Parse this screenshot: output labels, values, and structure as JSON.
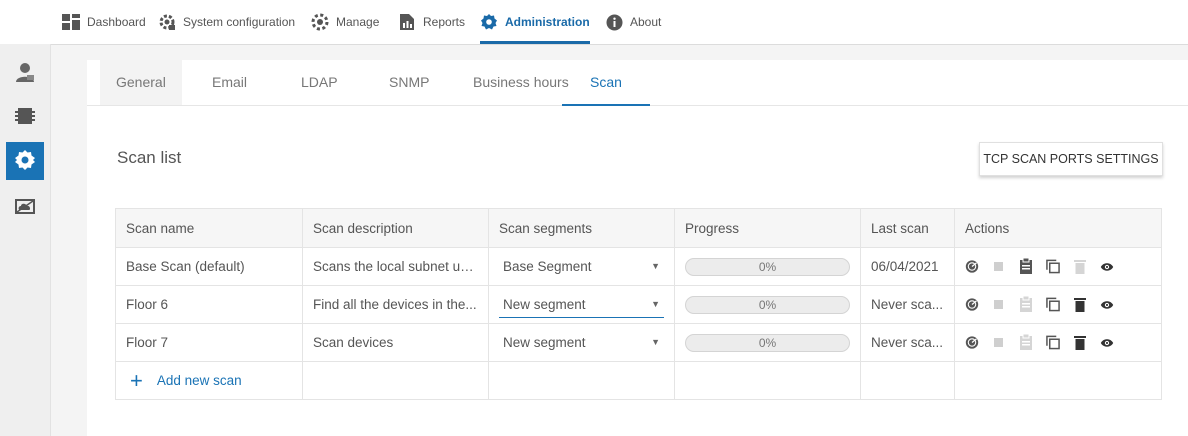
{
  "topnav": {
    "items": [
      {
        "label": "Dashboard",
        "icon": "dashboard-icon"
      },
      {
        "label": "System configuration",
        "icon": "system-config-icon"
      },
      {
        "label": "Manage",
        "icon": "manage-icon"
      },
      {
        "label": "Reports",
        "icon": "reports-icon"
      },
      {
        "label": "Administration",
        "icon": "administration-icon"
      },
      {
        "label": "About",
        "icon": "info-icon"
      }
    ],
    "active": "Administration"
  },
  "sidebar": {
    "items": [
      {
        "icon": "user-icon"
      },
      {
        "icon": "chip-icon"
      },
      {
        "icon": "gear-icon",
        "active": true
      },
      {
        "icon": "cloud-icon"
      }
    ]
  },
  "tabs": [
    {
      "label": "General"
    },
    {
      "label": "Email"
    },
    {
      "label": "LDAP"
    },
    {
      "label": "SNMP"
    },
    {
      "label": "Business hours"
    },
    {
      "label": "Scan",
      "active": true
    }
  ],
  "page": {
    "title": "Scan list",
    "tcp_button": "TCP SCAN PORTS SETTINGS",
    "add_label": "Add new scan"
  },
  "table": {
    "headers": [
      "Scan name",
      "Scan description",
      "Scan segments",
      "Progress",
      "Last scan",
      "Actions"
    ],
    "rows": [
      {
        "name": "Base Scan (default)",
        "description": "Scans the local subnet us...",
        "segment": "Base Segment",
        "progress": "0%",
        "last_scan": "06/04/2021"
      },
      {
        "name": "Floor 6",
        "description": "Find all the devices in the...",
        "segment": "New segment",
        "progress": "0%",
        "last_scan": "Never sca..."
      },
      {
        "name": "Floor 7",
        "description": "Scan devices",
        "segment": "New segment",
        "progress": "0%",
        "last_scan": "Never sca..."
      }
    ]
  },
  "colors": {
    "accent": "#1a73b5",
    "background": "#f4f4f4",
    "panel": "#ffffff"
  }
}
